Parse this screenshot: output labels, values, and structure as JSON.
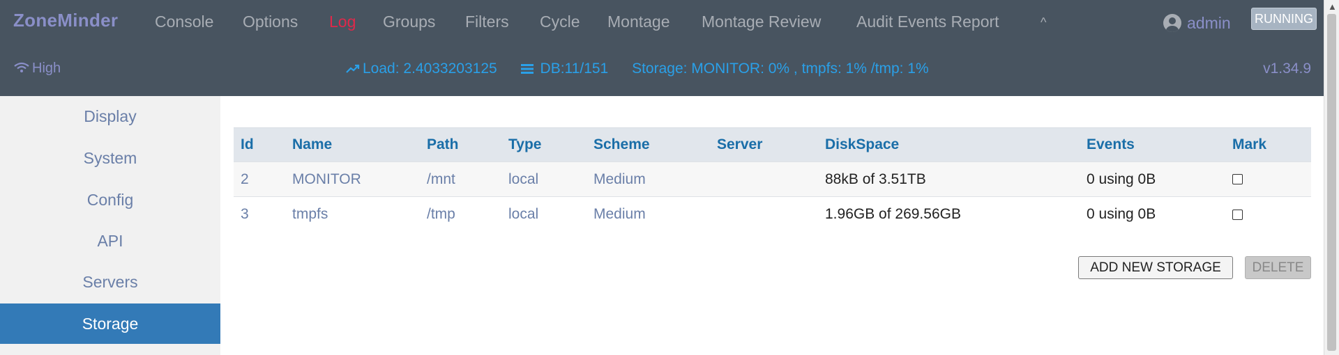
{
  "app": {
    "brand": "ZoneMinder",
    "nav": [
      {
        "label": "Console",
        "active": false
      },
      {
        "label": "Options",
        "active": false
      },
      {
        "label": "Log",
        "active": true
      },
      {
        "label": "Groups",
        "active": false
      },
      {
        "label": "Filters",
        "active": false
      },
      {
        "label": "Cycle",
        "active": false
      },
      {
        "label": "Montage",
        "active": false
      },
      {
        "label": "Montage Review",
        "active": false
      },
      {
        "label": "Audit Events Report",
        "active": false
      }
    ],
    "collapse_icon": "^",
    "user": "admin",
    "state": "RUNNING"
  },
  "status": {
    "bandwidth_icon": "wifi-icon",
    "bandwidth": "High",
    "load_icon": "trending-up-icon",
    "load": "Load: 2.4033203125",
    "db_icon": "database-icon",
    "db": "DB:11/151",
    "storage": "Storage: MONITOR: 0% , tmpfs: 1% /tmp: 1%",
    "version": "v1.34.9"
  },
  "sidebar": {
    "items": [
      {
        "label": "Display",
        "active": false
      },
      {
        "label": "System",
        "active": false
      },
      {
        "label": "Config",
        "active": false
      },
      {
        "label": "API",
        "active": false
      },
      {
        "label": "Servers",
        "active": false
      },
      {
        "label": "Storage",
        "active": true
      }
    ]
  },
  "table": {
    "columns": [
      "Id",
      "Name",
      "Path",
      "Type",
      "Scheme",
      "Server",
      "DiskSpace",
      "Events",
      "Mark"
    ],
    "rows": [
      {
        "id": "2",
        "name": "MONITOR",
        "path": "/mnt",
        "type": "local",
        "scheme": "Medium",
        "server": "",
        "diskspace": "88kB of 3.51TB",
        "events": "0 using 0B",
        "mark": false
      },
      {
        "id": "3",
        "name": "tmpfs",
        "path": "/tmp",
        "type": "local",
        "scheme": "Medium",
        "server": "",
        "diskspace": "1.96GB of 269.56GB",
        "events": "0 using 0B",
        "mark": false
      }
    ]
  },
  "actions": {
    "add": "ADD NEW STORAGE",
    "delete": "DELETE"
  },
  "colors": {
    "header_bg": "#485460",
    "brand": "#8a8fc8",
    "nav_active": "#e0284a",
    "status_text": "#2aa0e8",
    "sidebar_active": "#337ab7",
    "column_header": "#1a6ea8"
  }
}
